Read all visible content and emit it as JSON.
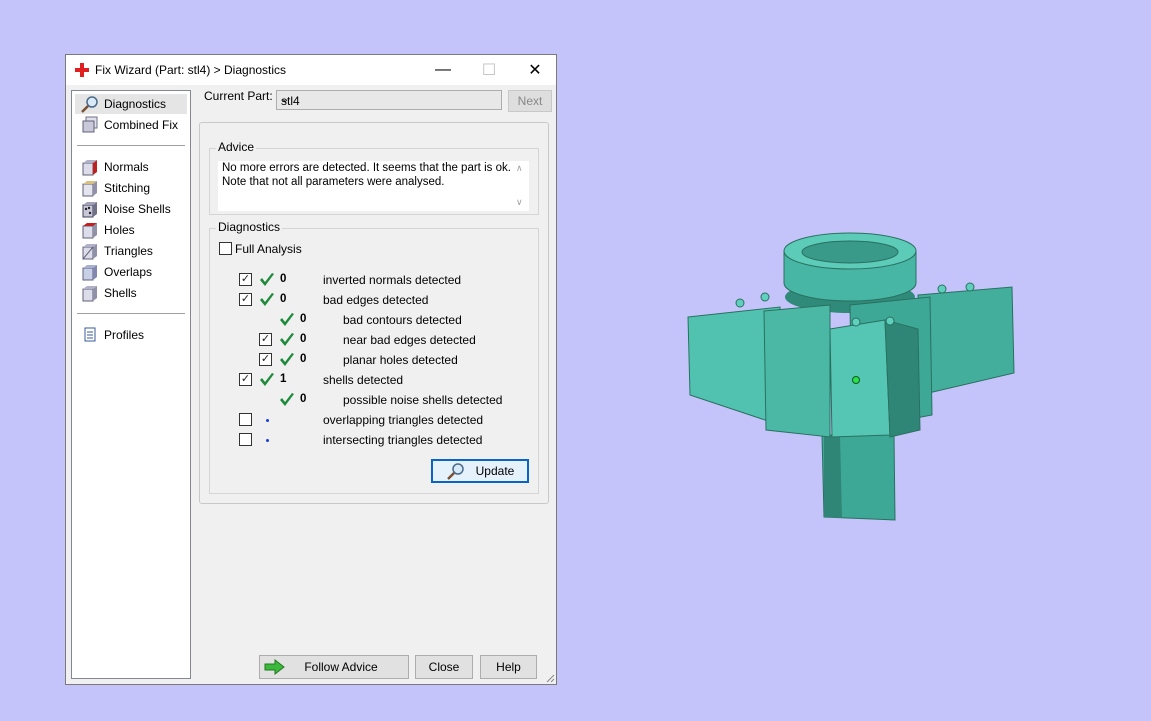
{
  "window": {
    "title": "Fix Wizard (Part: stl4) > Diagnostics",
    "controls": {
      "minimize": "—",
      "maximize": "☐",
      "close": "✕"
    }
  },
  "sidebar": {
    "items": [
      {
        "label": "Diagnostics",
        "icon": "magnifier-icon",
        "selected": true
      },
      {
        "label": "Combined Fix",
        "icon": "combined-fix-icon"
      },
      {
        "label": "Normals",
        "icon": "normals-cube-icon"
      },
      {
        "label": "Stitching",
        "icon": "stitching-cube-icon"
      },
      {
        "label": "Noise Shells",
        "icon": "noise-shells-cube-icon"
      },
      {
        "label": "Holes",
        "icon": "holes-cube-icon"
      },
      {
        "label": "Triangles",
        "icon": "triangles-cube-icon"
      },
      {
        "label": "Overlaps",
        "icon": "overlaps-cube-icon"
      },
      {
        "label": "Shells",
        "icon": "shells-cube-icon"
      },
      {
        "label": "Profiles",
        "icon": "profiles-document-icon"
      }
    ]
  },
  "current_part": {
    "label": "Current Part:",
    "value": "stl4",
    "next_label": "Next"
  },
  "advice": {
    "title": "Advice",
    "line1": "No more errors are detected. It seems that the part is ok.",
    "line2": "Note that not all parameters were analysed."
  },
  "diagnostics": {
    "title": "Diagnostics",
    "full_analysis_label": "Full Analysis",
    "full_analysis_checked": false,
    "rows": [
      {
        "checked": true,
        "status": "ok",
        "count": "0",
        "label": "inverted normals detected",
        "indent": 0,
        "checkbox": true
      },
      {
        "checked": true,
        "status": "ok",
        "count": "0",
        "label": "bad edges detected",
        "indent": 0,
        "checkbox": true
      },
      {
        "checked": false,
        "status": "ok",
        "count": "0",
        "label": "bad contours detected",
        "indent": 1,
        "checkbox": false
      },
      {
        "checked": true,
        "status": "ok",
        "count": "0",
        "label": "near bad edges detected",
        "indent": 1,
        "checkbox": true
      },
      {
        "checked": true,
        "status": "ok",
        "count": "0",
        "label": "planar holes detected",
        "indent": 1,
        "checkbox": true
      },
      {
        "checked": true,
        "status": "ok",
        "count": "1",
        "label": "shells detected",
        "indent": 0,
        "checkbox": true
      },
      {
        "checked": false,
        "status": "ok",
        "count": "0",
        "label": "possible noise shells detected",
        "indent": 1,
        "checkbox": false
      },
      {
        "checked": false,
        "status": "pending",
        "count": "",
        "label": "overlapping triangles detected",
        "indent": 0,
        "checkbox": true
      },
      {
        "checked": false,
        "status": "pending",
        "count": "",
        "label": "intersecting triangles detected",
        "indent": 0,
        "checkbox": true
      }
    ],
    "update_label": "Update"
  },
  "footer": {
    "follow_advice_label": "Follow Advice",
    "close_label": "Close",
    "help_label": "Help"
  },
  "colors": {
    "desktop": "#c5c4fa",
    "model": "#4fbfae",
    "check": "#1e8a3c",
    "accent": "#0a64c8"
  }
}
